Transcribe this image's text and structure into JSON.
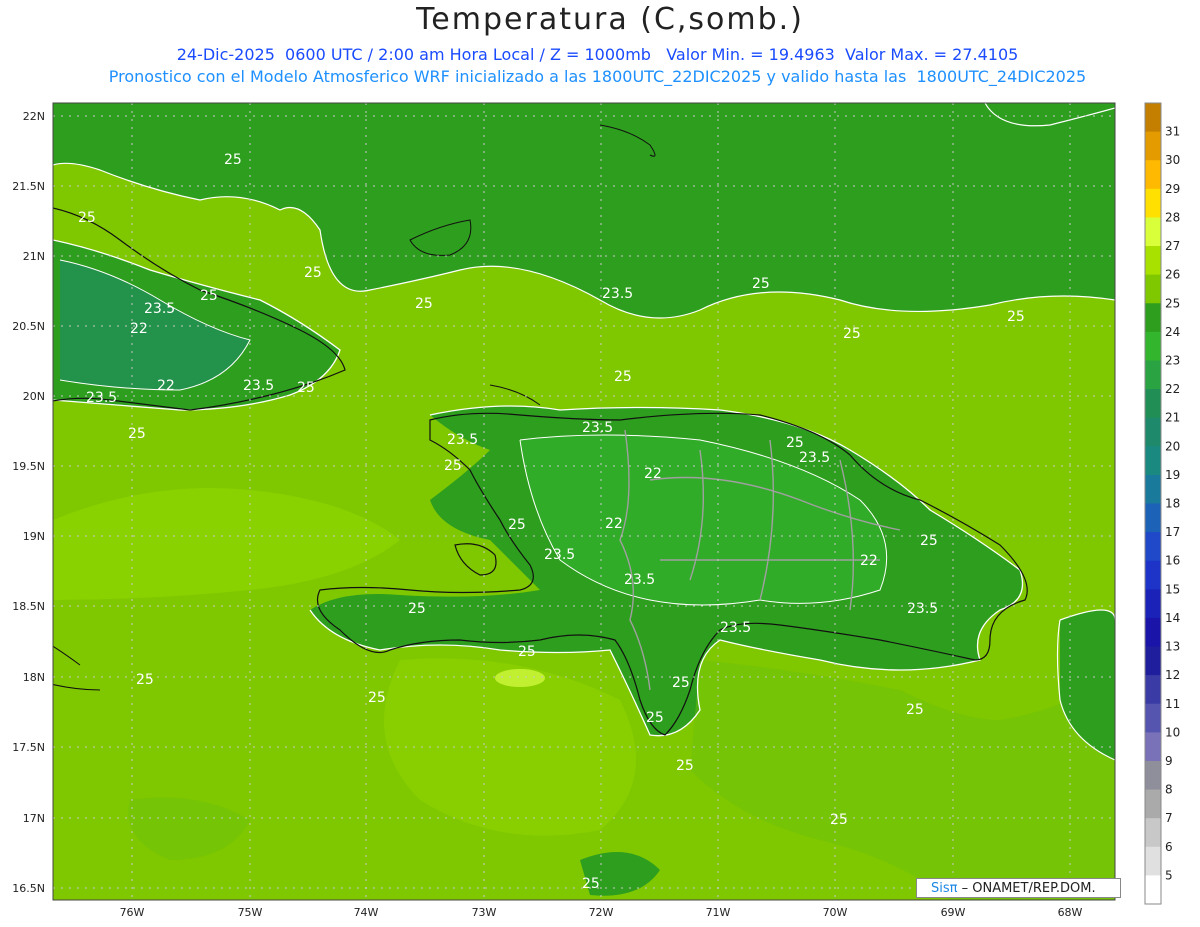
{
  "title": "Temperatura (C,somb.)",
  "subtitle_line1": "24-Dic-2025  0600 UTC / 2:00 am Hora Local / Z = 1000mb   Valor Min. = 19.4963  Valor Max. = 27.4105",
  "subtitle_line2": "Pronostico con el Modelo Atmosferico WRF inicializado a las 1800UTC_22DIC2025 y valido hasta las  1800UTC_24DIC2025",
  "credit": {
    "logo": "Sisπ",
    "text": " – ONAMET/REP.DOM."
  },
  "axes": {
    "lat_labels": [
      "22N",
      "21.5N",
      "21N",
      "20.5N",
      "20N",
      "19.5N",
      "19N",
      "18.5N",
      "18N",
      "17.5N",
      "17N",
      "16.5N"
    ],
    "lon_labels": [
      "76W",
      "75W",
      "74W",
      "73W",
      "72W",
      "71W",
      "70W",
      "69W",
      "68W"
    ]
  },
  "colorbar": {
    "levels": [
      31,
      30,
      29,
      28,
      27,
      26,
      25,
      24,
      23,
      22,
      21,
      20,
      19,
      18,
      17,
      16,
      15,
      14,
      13,
      12,
      11,
      10,
      9,
      8,
      7,
      6,
      5
    ],
    "colors": [
      "#c47f00",
      "#e39b00",
      "#ffb900",
      "#ffe000",
      "#d8ff3a",
      "#a8e000",
      "#7fc800",
      "#2e9e1e",
      "#33b52e",
      "#2aa442",
      "#218f55",
      "#1f8a6b",
      "#1a8a80",
      "#1a7a9c",
      "#1c63b8",
      "#1f49c8",
      "#1e34c9",
      "#1a22b8",
      "#1a14a8",
      "#1f1f9e",
      "#3b3ba6",
      "#5555b0",
      "#7a72b8",
      "#8f8f9c",
      "#aaaaaa",
      "#c8c8c8",
      "#e0e0e0",
      "#ffffff"
    ]
  },
  "contour_labels": [
    {
      "text": "25"
    },
    {
      "text": "25"
    },
    {
      "text": "25"
    },
    {
      "text": "25"
    },
    {
      "text": "23.5"
    },
    {
      "text": "22"
    },
    {
      "text": "22"
    },
    {
      "text": "23.5"
    },
    {
      "text": "25"
    },
    {
      "text": "23.5"
    },
    {
      "text": "25"
    },
    {
      "text": "25"
    },
    {
      "text": "23.5"
    },
    {
      "text": "25"
    },
    {
      "text": "25"
    },
    {
      "text": "25"
    },
    {
      "text": "23.5"
    },
    {
      "text": "25"
    },
    {
      "text": "23.5"
    },
    {
      "text": "25"
    },
    {
      "text": "22"
    },
    {
      "text": "23.5"
    },
    {
      "text": "25"
    },
    {
      "text": "22"
    },
    {
      "text": "23.5"
    },
    {
      "text": "25"
    },
    {
      "text": "23.5"
    },
    {
      "text": "22"
    },
    {
      "text": "25"
    },
    {
      "text": "25"
    },
    {
      "text": "23.5"
    },
    {
      "text": "23.5"
    },
    {
      "text": "25"
    },
    {
      "text": "25"
    },
    {
      "text": "25"
    },
    {
      "text": "25"
    },
    {
      "text": "25"
    },
    {
      "text": "25"
    },
    {
      "text": "25"
    },
    {
      "text": "25"
    },
    {
      "text": "25"
    }
  ]
}
